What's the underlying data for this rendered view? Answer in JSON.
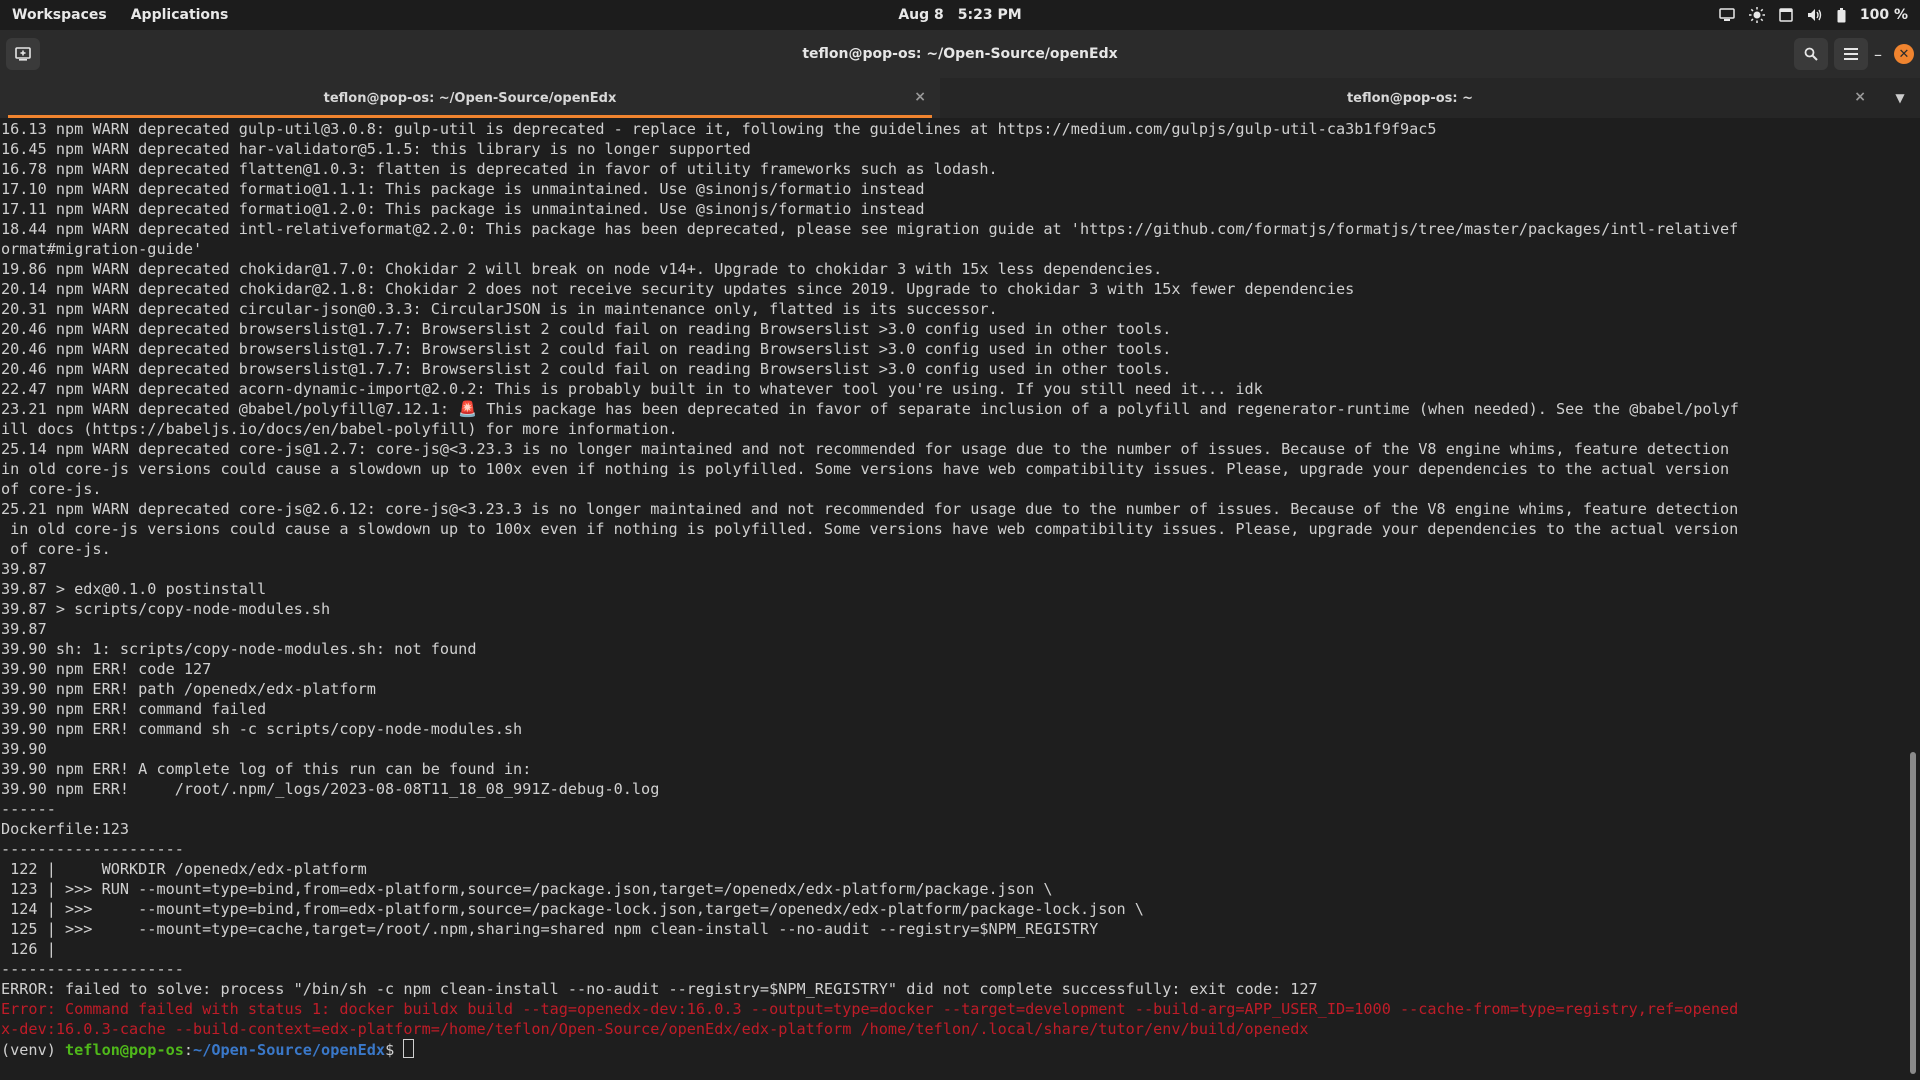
{
  "topbar": {
    "workspaces": "Workspaces",
    "applications": "Applications",
    "date": "Aug 8",
    "time": "5:23 PM",
    "battery": "100 %"
  },
  "window": {
    "title": "teflon@pop-os: ~/Open-Source/openEdx"
  },
  "tabs": [
    {
      "label": "teflon@pop-os: ~/Open-Source/openEdx",
      "active": true
    },
    {
      "label": "teflon@pop-os: ~",
      "active": false
    }
  ],
  "terminal": {
    "lines": [
      "16.13 npm WARN deprecated gulp-util@3.0.8: gulp-util is deprecated - replace it, following the guidelines at https://medium.com/gulpjs/gulp-util-ca3b1f9f9ac5",
      "16.45 npm WARN deprecated har-validator@5.1.5: this library is no longer supported",
      "16.78 npm WARN deprecated flatten@1.0.3: flatten is deprecated in favor of utility frameworks such as lodash.",
      "17.10 npm WARN deprecated formatio@1.1.1: This package is unmaintained. Use @sinonjs/formatio instead",
      "17.11 npm WARN deprecated formatio@1.2.0: This package is unmaintained. Use @sinonjs/formatio instead",
      "18.44 npm WARN deprecated intl-relativeformat@2.2.0: This package has been deprecated, please see migration guide at 'https://github.com/formatjs/formatjs/tree/master/packages/intl-relativef",
      "ormat#migration-guide'",
      "19.86 npm WARN deprecated chokidar@1.7.0: Chokidar 2 will break on node v14+. Upgrade to chokidar 3 with 15x less dependencies.",
      "20.14 npm WARN deprecated chokidar@2.1.8: Chokidar 2 does not receive security updates since 2019. Upgrade to chokidar 3 with 15x fewer dependencies",
      "20.31 npm WARN deprecated circular-json@0.3.3: CircularJSON is in maintenance only, flatted is its successor.",
      "20.46 npm WARN deprecated browserslist@1.7.7: Browserslist 2 could fail on reading Browserslist >3.0 config used in other tools.",
      "20.46 npm WARN deprecated browserslist@1.7.7: Browserslist 2 could fail on reading Browserslist >3.0 config used in other tools.",
      "20.46 npm WARN deprecated browserslist@1.7.7: Browserslist 2 could fail on reading Browserslist >3.0 config used in other tools.",
      "22.47 npm WARN deprecated acorn-dynamic-import@2.0.2: This is probably built in to whatever tool you're using. If you still need it... idk",
      "23.21 npm WARN deprecated @babel/polyfill@7.12.1: 🚨 This package has been deprecated in favor of separate inclusion of a polyfill and regenerator-runtime (when needed). See the @babel/polyf",
      "ill docs (https://babeljs.io/docs/en/babel-polyfill) for more information.",
      "25.14 npm WARN deprecated core-js@1.2.7: core-js@<3.23.3 is no longer maintained and not recommended for usage due to the number of issues. Because of the V8 engine whims, feature detection",
      "in old core-js versions could cause a slowdown up to 100x even if nothing is polyfilled. Some versions have web compatibility issues. Please, upgrade your dependencies to the actual version",
      "of core-js.",
      "25.21 npm WARN deprecated core-js@2.6.12: core-js@<3.23.3 is no longer maintained and not recommended for usage due to the number of issues. Because of the V8 engine whims, feature detection",
      " in old core-js versions could cause a slowdown up to 100x even if nothing is polyfilled. Some versions have web compatibility issues. Please, upgrade your dependencies to the actual version",
      " of core-js.",
      "39.87",
      "39.87 > edx@0.1.0 postinstall",
      "39.87 > scripts/copy-node-modules.sh",
      "39.87",
      "39.90 sh: 1: scripts/copy-node-modules.sh: not found",
      "39.90 npm ERR! code 127",
      "39.90 npm ERR! path /openedx/edx-platform",
      "39.90 npm ERR! command failed",
      "39.90 npm ERR! command sh -c scripts/copy-node-modules.sh",
      "39.90",
      "39.90 npm ERR! A complete log of this run can be found in:",
      "39.90 npm ERR!     /root/.npm/_logs/2023-08-08T11_18_08_991Z-debug-0.log",
      "------",
      "Dockerfile:123",
      "--------------------",
      " 122 |     WORKDIR /openedx/edx-platform",
      " 123 | >>> RUN --mount=type=bind,from=edx-platform,source=/package.json,target=/openedx/edx-platform/package.json \\",
      " 124 | >>>     --mount=type=bind,from=edx-platform,source=/package-lock.json,target=/openedx/edx-platform/package-lock.json \\",
      " 125 | >>>     --mount=type=cache,target=/root/.npm,sharing=shared npm clean-install --no-audit --registry=$NPM_REGISTRY",
      " 126 |",
      "--------------------",
      "ERROR: failed to solve: process \"/bin/sh -c npm clean-install --no-audit --registry=$NPM_REGISTRY\" did not complete successfully: exit code: 127"
    ],
    "error_lines": [
      "Error: Command failed with status 1: docker buildx build --tag=openedx-dev:16.0.3 --output=type=docker --target=development --build-arg=APP_USER_ID=1000 --cache-from=type=registry,ref=opened",
      "x-dev:16.0.3-cache --build-context=edx-platform=/home/teflon/Open-Source/openEdx/edx-platform /home/teflon/.local/share/tutor/env/build/openedx"
    ],
    "prompt": {
      "venv": "(venv) ",
      "user": "teflon@pop-os",
      "sep": ":",
      "path": "~/Open-Source/openEdx",
      "symbol": "$ "
    }
  },
  "colors": {
    "accent": "#f0842f",
    "error": "#c01c28",
    "prompt_user": "#4fb81a",
    "prompt_path": "#3a78c9"
  }
}
